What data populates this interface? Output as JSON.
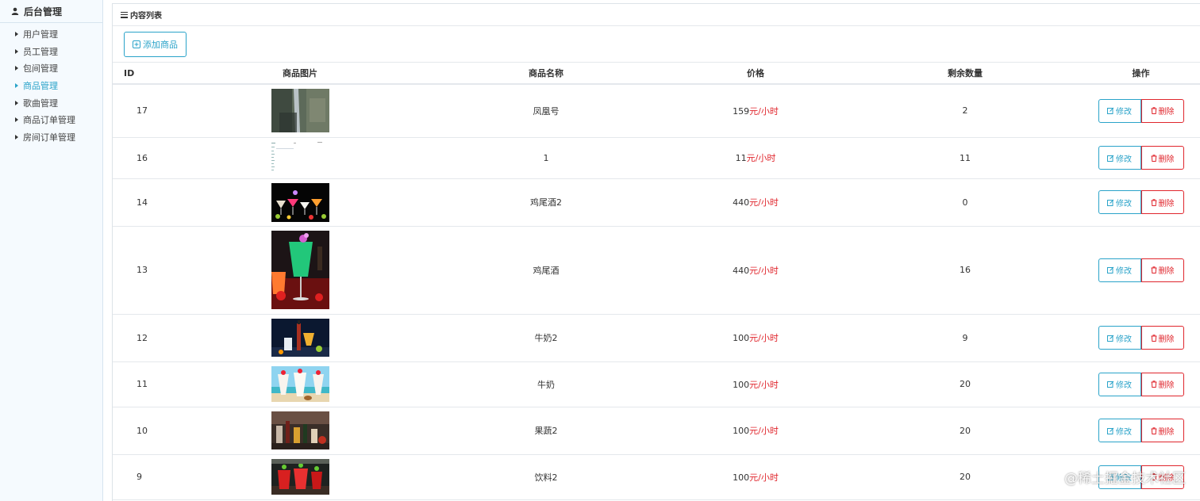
{
  "sidebar": {
    "title": "后台管理",
    "items": [
      {
        "label": "用户管理",
        "active": false
      },
      {
        "label": "员工管理",
        "active": false
      },
      {
        "label": "包间管理",
        "active": false
      },
      {
        "label": "商品管理",
        "active": true
      },
      {
        "label": "歌曲管理",
        "active": false
      },
      {
        "label": "商品订单管理",
        "active": false
      },
      {
        "label": "房间订单管理",
        "active": false
      }
    ]
  },
  "panel": {
    "title": "内容列表",
    "add_button": "添加商品"
  },
  "table": {
    "headers": {
      "id": "ID",
      "image": "商品图片",
      "name": "商品名称",
      "price": "价格",
      "stock": "剩余数量",
      "actions": "操作"
    },
    "price_unit": "元/小时",
    "edit_label": "修改",
    "delete_label": "删除",
    "rows": [
      {
        "id": "17",
        "name": "凤凰号",
        "price": "159",
        "stock": "2",
        "image": "rock-canyon"
      },
      {
        "id": "16",
        "name": "1",
        "price": "11",
        "stock": "11",
        "image": "screenshot-thumbnail"
      },
      {
        "id": "14",
        "name": "鸡尾酒2",
        "price": "440",
        "stock": "0",
        "image": "cocktail-row"
      },
      {
        "id": "13",
        "name": "鸡尾酒",
        "price": "440",
        "stock": "16",
        "image": "green-cocktail"
      },
      {
        "id": "12",
        "name": "牛奶2",
        "price": "100",
        "stock": "9",
        "image": "drinks-dark"
      },
      {
        "id": "11",
        "name": "牛奶",
        "price": "100",
        "stock": "20",
        "image": "beach-drinks"
      },
      {
        "id": "10",
        "name": "果蔬2",
        "price": "100",
        "stock": "20",
        "image": "bar-bottles"
      },
      {
        "id": "9",
        "name": "饮料2",
        "price": "100",
        "stock": "20",
        "image": "red-drinks"
      }
    ]
  },
  "watermark": {
    "text": "@稀土掘金技术社区"
  },
  "colors": {
    "accent": "#2aa3c9",
    "danger": "#e0262d",
    "sidebar_bg": "#f5fafe"
  }
}
